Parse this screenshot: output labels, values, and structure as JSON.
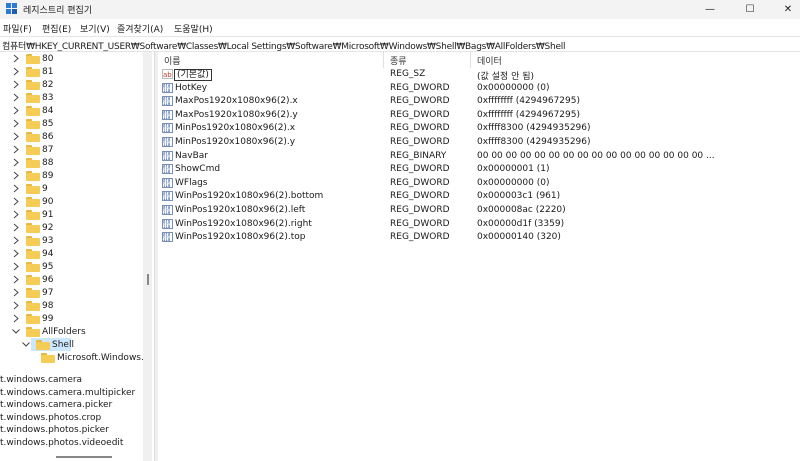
{
  "window": {
    "title": "레지스트리 편집기",
    "controls": {
      "minimize": "—",
      "maximize": "☐",
      "close": "✕"
    }
  },
  "menu": [
    "파일(F)",
    "편집(E)",
    "보기(V)",
    "즐겨찾기(A)",
    "도움말(H)"
  ],
  "address": "컴퓨터₩HKEY_CURRENT_USER₩Software₩Classes₩Local Settings₩Software₩Microsoft₩Windows₩Shell₩Bags₩AllFolders₩Shell",
  "tree": {
    "numbered": [
      "80",
      "81",
      "82",
      "83",
      "84",
      "85",
      "86",
      "87",
      "88",
      "89",
      "9",
      "90",
      "91",
      "92",
      "93",
      "94",
      "95",
      "96",
      "97",
      "98",
      "99"
    ],
    "allfolders": "AllFolders",
    "shell": "Shell",
    "child": "Microsoft.Windows.C",
    "truncated": [
      "t.windows.camera",
      "t.windows.camera.multipicker",
      "t.windows.camera.picker",
      "t.windows.photos.crop",
      "t.windows.photos.picker",
      "t.windows.photos.videoedit"
    ]
  },
  "columns": {
    "name": "이름",
    "type": "종류",
    "data": "데이터"
  },
  "values": [
    {
      "icon": "string-value-icon",
      "name": "(기본값)",
      "type": "REG_SZ",
      "data": "(값 설정 안 됨)"
    },
    {
      "icon": "binary-value-icon",
      "name": "HotKey",
      "type": "REG_DWORD",
      "data": "0x00000000 (0)"
    },
    {
      "icon": "binary-value-icon",
      "name": "MaxPos1920x1080x96(2).x",
      "type": "REG_DWORD",
      "data": "0xffffffff (4294967295)"
    },
    {
      "icon": "binary-value-icon",
      "name": "MaxPos1920x1080x96(2).y",
      "type": "REG_DWORD",
      "data": "0xffffffff (4294967295)"
    },
    {
      "icon": "binary-value-icon",
      "name": "MinPos1920x1080x96(2).x",
      "type": "REG_DWORD",
      "data": "0xffff8300 (4294935296)"
    },
    {
      "icon": "binary-value-icon",
      "name": "MinPos1920x1080x96(2).y",
      "type": "REG_DWORD",
      "data": "0xffff8300 (4294935296)"
    },
    {
      "icon": "binary-value-icon",
      "name": "NavBar",
      "type": "REG_BINARY",
      "data": "00 00 00 00 00 00 00 00 00 00 00 00 00 00 00 00 ..."
    },
    {
      "icon": "binary-value-icon",
      "name": "ShowCmd",
      "type": "REG_DWORD",
      "data": "0x00000001 (1)"
    },
    {
      "icon": "binary-value-icon",
      "name": "WFlags",
      "type": "REG_DWORD",
      "data": "0x00000000 (0)"
    },
    {
      "icon": "binary-value-icon",
      "name": "WinPos1920x1080x96(2).bottom",
      "type": "REG_DWORD",
      "data": "0x000003c1 (961)"
    },
    {
      "icon": "binary-value-icon",
      "name": "WinPos1920x1080x96(2).left",
      "type": "REG_DWORD",
      "data": "0x000008ac (2220)"
    },
    {
      "icon": "binary-value-icon",
      "name": "WinPos1920x1080x96(2).right",
      "type": "REG_DWORD",
      "data": "0x00000d1f (3359)"
    },
    {
      "icon": "binary-value-icon",
      "name": "WinPos1920x1080x96(2).top",
      "type": "REG_DWORD",
      "data": "0x00000140 (320)"
    }
  ],
  "colors": {
    "selection": "#cce8ff",
    "folder": "#f5cc55",
    "titlebar": "#f3f3f3"
  }
}
